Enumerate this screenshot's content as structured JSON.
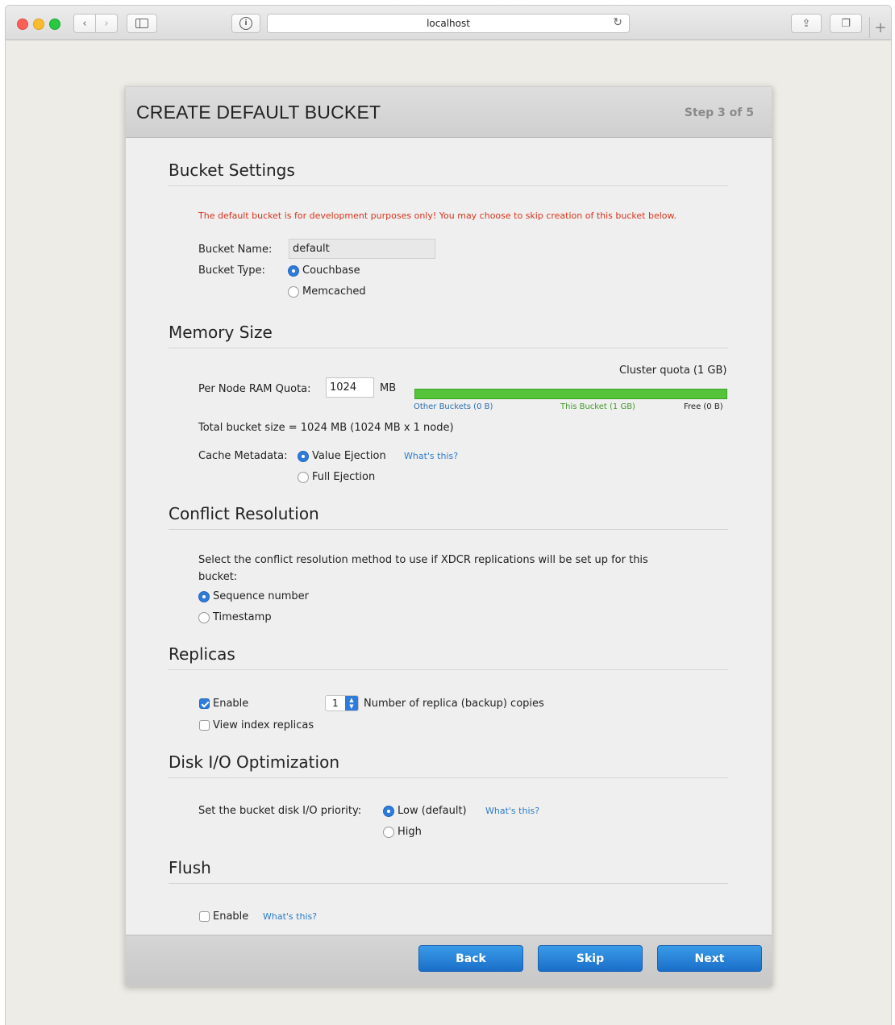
{
  "browser": {
    "address": "localhost",
    "back_glyph": "‹",
    "forward_glyph": "›",
    "reload_glyph": "↻",
    "new_tab_glyph": "+",
    "share_glyph": "⇪",
    "tabs_glyph": "❐",
    "privacy_glyph": "i"
  },
  "wizard": {
    "title": "CREATE DEFAULT BUCKET",
    "step": "Step 3 of 5"
  },
  "bucket_settings": {
    "heading": "Bucket Settings",
    "warning": "The default bucket is for development purposes only! You may choose to skip creation of this bucket below.",
    "name_label": "Bucket Name:",
    "name_value": "default",
    "type_label": "Bucket Type:",
    "type_options": [
      "Couchbase",
      "Memcached"
    ],
    "type_selected": "Couchbase"
  },
  "memory": {
    "heading": "Memory Size",
    "quota_label": "Per Node RAM Quota:",
    "quota_value": "1024",
    "quota_unit": "MB",
    "cluster_quota": "Cluster quota (1 GB)",
    "bar_other": "Other Buckets (0 B)",
    "bar_this": "This Bucket (1 GB)",
    "bar_free": "Free (0 B)",
    "bar_this_fraction": 1.0,
    "total": "Total bucket size = 1024 MB (1024 MB x 1 node)",
    "cache_label": "Cache Metadata:",
    "cache_options": [
      "Value Ejection",
      "Full Ejection"
    ],
    "cache_selected": "Value Ejection",
    "whats_this": "What's this?"
  },
  "conflict": {
    "heading": "Conflict Resolution",
    "description_line1": "Select the conflict resolution method to use if XDCR replications will be set up for this",
    "description_line2": "bucket:",
    "options": [
      "Sequence number",
      "Timestamp"
    ],
    "selected": "Sequence number"
  },
  "replicas": {
    "heading": "Replicas",
    "enable_label": "Enable",
    "enable_checked": true,
    "count": "1",
    "count_label": "Number of replica (backup) copies",
    "view_index_label": "View index replicas",
    "view_index_checked": false
  },
  "disk_io": {
    "heading": "Disk I/O Optimization",
    "priority_label": "Set the bucket disk I/O priority:",
    "options": [
      "Low (default)",
      "High"
    ],
    "selected": "Low (default)",
    "whats_this": "What's this?"
  },
  "flush": {
    "heading": "Flush",
    "enable_label": "Enable",
    "enable_checked": false,
    "whats_this": "What's this?"
  },
  "buttons": {
    "back": "Back",
    "skip": "Skip",
    "next": "Next"
  },
  "colors": {
    "accent": "#2f7bdb",
    "warning": "#d8351f",
    "quota_bar": "#55c43a",
    "link": "#2b7bc9"
  }
}
